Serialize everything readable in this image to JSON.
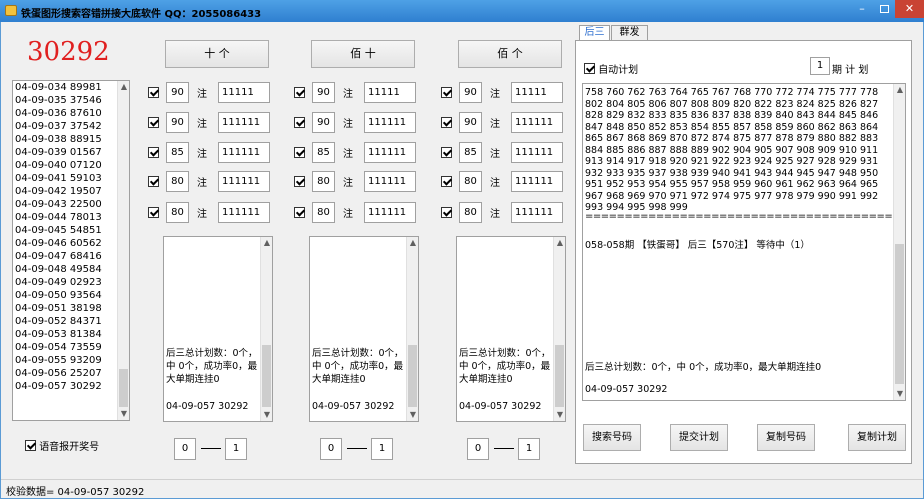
{
  "window": {
    "title": "铁蛋图形搜索容错拼接大底软件   QQ：2055086433",
    "minimize": "–",
    "close": "✕"
  },
  "latest_number": "30292",
  "history": [
    "04-09-034 89981",
    "04-09-035 37546",
    "04-09-036 87610",
    "04-09-037 37542",
    "04-09-038 88915",
    "04-09-039 01567",
    "04-09-040 07120",
    "04-09-041 59103",
    "04-09-042 19507",
    "04-09-043 22500",
    "04-09-044 78013",
    "04-09-045 54851",
    "04-09-046 60562",
    "04-09-047 68416",
    "04-09-048 49584",
    "04-09-049 02923",
    "04-09-050 93564",
    "04-09-051 38198",
    "04-09-052 84371",
    "04-09-053 81384",
    "04-09-054 73559",
    "04-09-055 93209",
    "04-09-056 25207",
    "04-09-057 30292"
  ],
  "voice_label": "语音报开奖号",
  "columns": [
    {
      "header": "十    个",
      "rows": [
        {
          "count": "90",
          "unit": "注",
          "code": "11111"
        },
        {
          "count": "90",
          "unit": "注",
          "code": "111111"
        },
        {
          "count": "85",
          "unit": "注",
          "code": "111111"
        },
        {
          "count": "80",
          "unit": "注",
          "code": "111111"
        },
        {
          "count": "80",
          "unit": "注",
          "code": "111111"
        }
      ],
      "memo_text": "后三总计划数：0个，中 0个，成功率0，最大单期连挂0",
      "memo_last": "04-09-057 30292",
      "range_from": "0",
      "range_to": "1"
    },
    {
      "header": "佰    十",
      "rows": [
        {
          "count": "90",
          "unit": "注",
          "code": "11111"
        },
        {
          "count": "90",
          "unit": "注",
          "code": "111111"
        },
        {
          "count": "85",
          "unit": "注",
          "code": "111111"
        },
        {
          "count": "80",
          "unit": "注",
          "code": "111111"
        },
        {
          "count": "80",
          "unit": "注",
          "code": "111111"
        }
      ],
      "memo_text": "后三总计划数：0个，中 0个，成功率0，最大单期连挂0",
      "memo_last": "04-09-057 30292",
      "range_from": "0",
      "range_to": "1"
    },
    {
      "header": "佰    个",
      "rows": [
        {
          "count": "90",
          "unit": "注",
          "code": "11111"
        },
        {
          "count": "90",
          "unit": "注",
          "code": "111111"
        },
        {
          "count": "85",
          "unit": "注",
          "code": "111111"
        },
        {
          "count": "80",
          "unit": "注",
          "code": "111111"
        },
        {
          "count": "80",
          "unit": "注",
          "code": "111111"
        }
      ],
      "memo_text": "后三总计划数：0个，中 0个，成功率0，最大单期连挂0",
      "memo_last": "04-09-057 30292",
      "range_from": "0",
      "range_to": "1"
    }
  ],
  "right_panel": {
    "tabs": [
      "后三",
      "群发"
    ],
    "auto_plan_label": "自动计划",
    "period_value": "1",
    "period_label": "期 计 划",
    "numbers_text": "758 760 762 763 764 765 767 768 770 772 774 775 777 778 802 804 805 806 807 808 809 820 822 823 824 825 826 827 828 829 832 833 835 836 837 838 839 840 843 844 845 846 847 848 850 852 853 854 855 857 858 859 860 862 863 864 865 867 868 869 870 872 874 875 877 878 879 880 882 883 884 885 886 887 888 889 902 904 905 907 908 909 910 911 913 914 917 918 920 921 922 923 924 925 927 928 929 931 932 933 935 937 938 939 940 941 943 944 945 947 948 950 951 952 953 954 955 957 958 959 960 961 962 963 964 965 967 968 969 970 971 972 974 975 977 978 979 990 991 992 993 994 995 998 999",
    "separator": "==========================================",
    "issue_line": "058-058期 【铁蛋哥】 后三【570注】 等待中（1）",
    "summary_line": "后三总计划数：0个，中 0个，成功率0，最大单期连挂0",
    "last_line": "04-09-057 30292",
    "buttons": [
      "搜索号码",
      "提交计划",
      "复制号码",
      "复制计划"
    ]
  },
  "status_bar": "校验数据= 04-09-057 30292"
}
